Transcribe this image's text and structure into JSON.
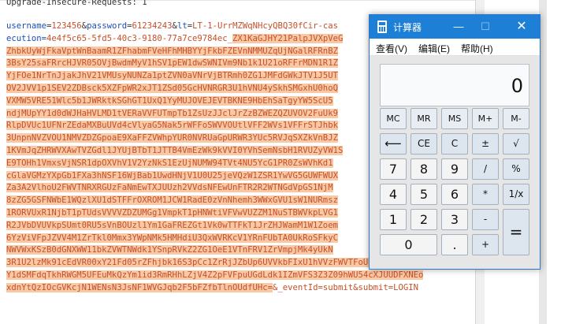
{
  "editor": {
    "header_line": "Upgrade-Insecure-Requests: 1",
    "form": {
      "username_key": "username",
      "username_val": "123456",
      "password_key": "password",
      "password_val": "61234243",
      "lt_key": "lt",
      "lt_val": "LT-1-UrrMZWqNHcyQBQ30fCir-cas",
      "execution_prefix": "ecution=",
      "execution_val": "4e4f5c65-5fd5-40c3-9180-77a7ce9784ec_",
      "encoded_first": "ZX1KaGJHY21PalpJVXpVeG",
      "encoded_lines": [
        "ZhbkUyWjFkaVptWnBaamR1ZFhabmFVeHFhMHBYYjFkbFZEVnNMMUZqUjNGalRFRnBZ",
        "3BsY25saFRrcHJVR05OVjBwdmMyV1hSV1pEW1dwSWNIVm9Nb1k1U21oRFFrMDN1R1Z",
        "YjFOe1NrTnJjakJhV21VMUsyNUNZa1ptZVN0aVNrVjBTRmh0ZG1JMFdGWkJTV1J5UT",
        "OV2JVV1p1SEV2ZDBsck5XZFpWR2xJT1ZSd05GcHVNRGR3U1hVNU4ySkhSMGxhU0hoQ",
        "VXMW5VRE51Wlc5b1JWRktkSGhGT1UxQ1YyMUJOVEJEVTBKNE9HbEhSaTgyYW5ScU5",
        "ndjMUpYY1d0dWJHaHVLMD1tVERaVVFUTmpTb1ZsUzJJclJrZzBZWEZQZUVOV2FuUk9",
        "RlpDVUc1UFNrZEdaMXBuUVd4cVlyaG5Nak5rWFFoSWVVOUtlVFF2WVs1VFFrSTJhbk",
        "3UnpnNVZVOU1NMVZDZGpoaE9XaFFZVWhpYUR0NVRUaGpURWR3YUc5RVJqSXZkVnBJZ",
        "1KVmJqZHRWVXAwTVZGdl1JYUjBTbT1JTTB4VmEzWk9kVVI0YVhSemNsbH1RVUZyVW1S",
        "E9TOHh1VmxsVjNSR1dpOXVhV1V2YzNkS1EzUjNUMW94TVt4NU5YcG1PR0ZsWVhKd1",
        "cGlaVGMzYXpGb1FXa3hNSF16WjBab1UwdHNjV1U0U25jeVQzW1ZSR1YwVG5GUWFWUX",
        "Za3A2VlhoU2FWVTNRXRGUzFaNmEwTXJUUzh2VVdsNFEwUnFTR2R2WTNGdVpGS1NjM",
        "8zZG5GSFNWbE1WQzlXU1dSTFFrOXROM1JCW1RadE0zVnNhemh3WWxGVU1sW1NURmsz",
        "1RORVUxR1NjbT1pTUdsVVVVZDZUMGg1VmpkT1pHNWtiVFVwVUZZM1NuSTBWVkpLVG1",
        "R2JVbDVUVkpSUmt0RU5sVnBOUzl1Ym1GaFREZGt1Vk0wTTFkT1JrZHJWamM1W1Zoem",
        "6YzViVFpJZVV4M1ZrTkl0Mmx3YWpNMk5HMHdiU3QxWVRKcV1YRnFUbTA0UkRoSFkyC",
        "NWVWxKSzB0dGNXWW11bkZVWTNWdk1YSnpRVkZ2ZG1OeE1VTnFRV1ZrVmpjMk4yUkN",
        "3R1U2lzMk91cEdVR00xY21Fd05rZFhjbk16S3pCc1ZrRjJZbUp6UVVkbFIxU1hVVzFWVTFoU1drbHZaa0Uw",
        "Y1dSMFdqTkhRWGM5UFEuMkQzYm1id3RmRHhLZjV4Z2pFVFpuUGdLdk1IZmVFS3Z3Z09hWU54cXJUUDFXNEo"
      ],
      "encoded_last": "xdnYtQzIOcGVKcjN1WENsN3JsNF1WVGJqb2F5bFZfbTlnOUdfUHc=",
      "event_pair": "&_eventId=submit&submit=LOGIN"
    }
  },
  "calculator": {
    "title": "计算器",
    "menu": [
      "查看(V)",
      "编辑(E)",
      "帮助(H)"
    ],
    "display_value": "0",
    "memory_keys": [
      "MC",
      "MR",
      "MS",
      "M+",
      "M-"
    ],
    "keys_row1": [
      "⟵",
      "CE",
      "C",
      "±",
      "√"
    ],
    "keys_row2": [
      "7",
      "8",
      "9",
      "/",
      "%"
    ],
    "keys_row3": [
      "4",
      "5",
      "6",
      "*",
      "1/x"
    ],
    "keys_row4": [
      "1",
      "2",
      "3",
      "-"
    ],
    "key_equals": "=",
    "key_zero": "0",
    "key_dot": ".",
    "key_plus": "+"
  }
}
